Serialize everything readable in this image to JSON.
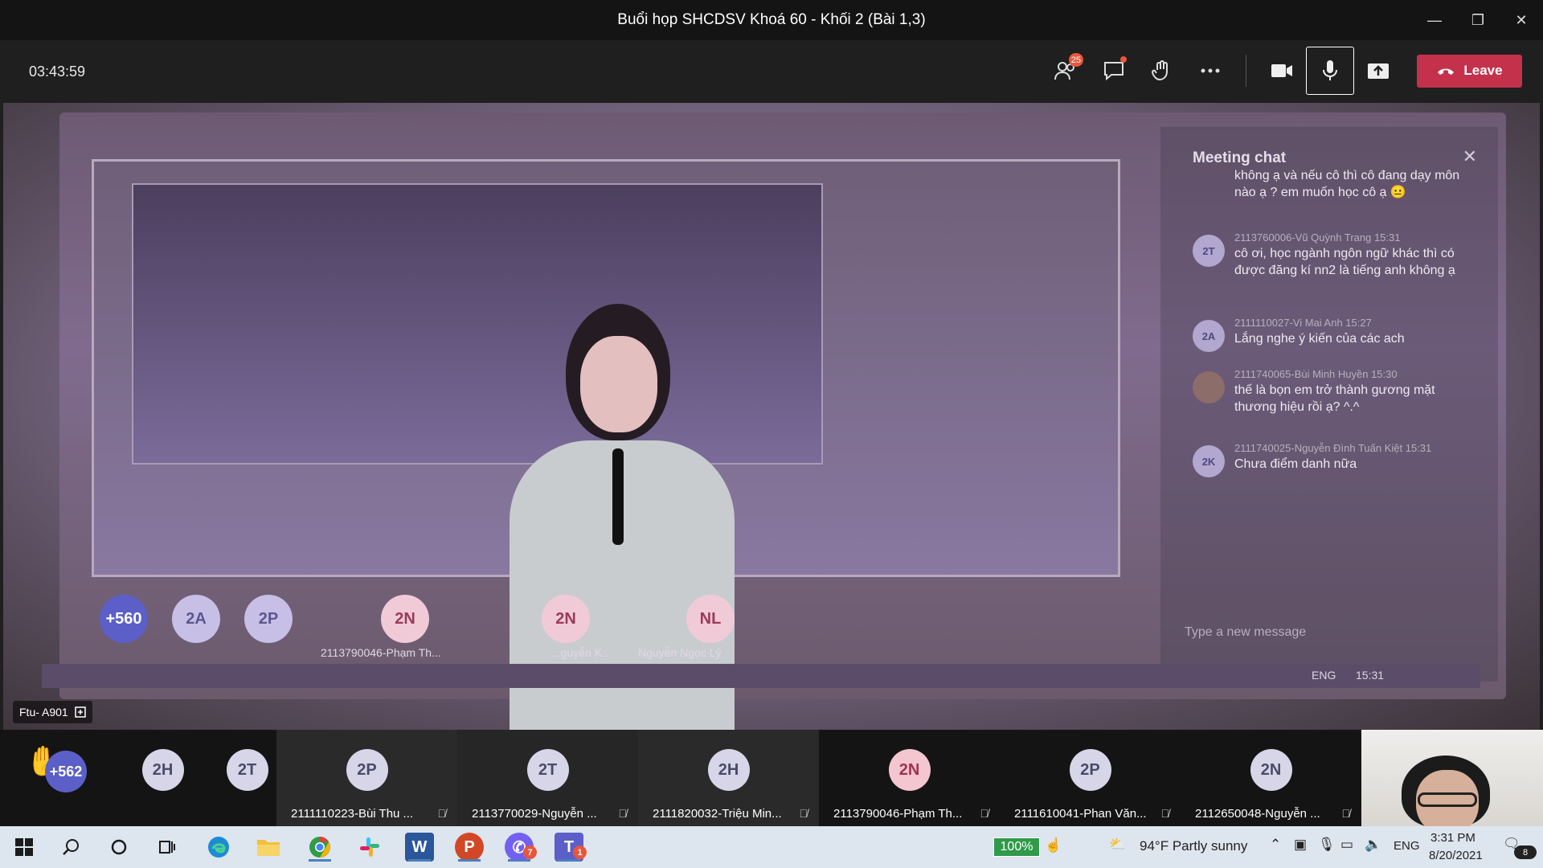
{
  "window": {
    "title": "Buổi họp SHCDSV Khoá 60 - Khối 2 (Bài 1,3)",
    "minimize": "—",
    "restore": "❐",
    "close": "✕"
  },
  "toolbar": {
    "timer": "03:43:59",
    "participants_count": "25",
    "leave_label": "Leave"
  },
  "stage": {
    "room_label": "Ftu- A901",
    "chat": {
      "title": "Meeting chat",
      "messages": [
        {
          "avatar": "",
          "meta": "",
          "text": "không ạ và nếu cô thì cô đang dạy môn nào ạ ? em muốn học cô ạ 😐"
        },
        {
          "avatar": "2T",
          "meta": "2113760006-Vũ Quỳnh Trang   15:31",
          "text": "cô ơi, học ngành ngôn ngữ khác thì có được đăng kí nn2 là tiếng anh không ạ"
        },
        {
          "avatar": "2A",
          "meta": "2111110027-Vi Mai Anh   15:27",
          "text": "Lắng nghe ý kiến của các ach"
        },
        {
          "avatar": "",
          "meta": "2111740065-Bùi Minh Huyền   15:30",
          "text": "thế là bọn em trở thành gương mặt thương hiệu rồi ạ? ^.^"
        },
        {
          "avatar": "2K",
          "meta": "2111740025-Nguyễn Đình Tuấn Kiệt   15:31",
          "text": "Chưa điểm danh nữa"
        }
      ],
      "input_placeholder": "Type a new message"
    },
    "gallery_on_screen": [
      {
        "avatar": "+560",
        "name": ""
      },
      {
        "avatar": "2A",
        "name": ""
      },
      {
        "avatar": "2P",
        "name": ""
      },
      {
        "avatar": "2N",
        "name": "2113790046-Phạm Th..."
      },
      {
        "avatar": "2N",
        "name": "...guyễn K..."
      },
      {
        "avatar": "NL",
        "name": "Nguyễn Ngọc Lý"
      }
    ],
    "screen_taskbar": {
      "lang": "ENG",
      "time": "15:31"
    }
  },
  "gallery": {
    "overflow_label": "+562",
    "tiles": [
      {
        "avatar": "2H",
        "name": "",
        "color": "#d7d6e8",
        "fg": "#4b4b6b"
      },
      {
        "avatar": "2T",
        "name": "",
        "color": "#d7d6e8",
        "fg": "#4b4b6b"
      },
      {
        "avatar": "2P",
        "name": "2111110223-Bùi Thu ...",
        "color": "#d7d6e8",
        "fg": "#4b4b6b"
      },
      {
        "avatar": "2T",
        "name": "2113770029-Nguyễn ...",
        "color": "#d7d6e8",
        "fg": "#4b4b6b"
      },
      {
        "avatar": "2H",
        "name": "2111820032-Triệu Min...",
        "color": "#d7d6e8",
        "fg": "#4b4b6b"
      },
      {
        "avatar": "2N",
        "name": "2113790046-Phạm Th...",
        "color": "#f4c6cf",
        "fg": "#a3324d"
      },
      {
        "avatar": "2P",
        "name": "2111610041-Phan Văn...",
        "color": "#d7d6e8",
        "fg": "#4b4b6b"
      },
      {
        "avatar": "2N",
        "name": "2112650048-Nguyễn ...",
        "color": "#d7d6e8",
        "fg": "#4b4b6b"
      }
    ]
  },
  "taskbar": {
    "apps": [
      "start",
      "search",
      "cortana",
      "task-view",
      "edge",
      "file-explorer",
      "chrome",
      "slack",
      "word",
      "powerpoint",
      "viber",
      "teams"
    ],
    "viber_badge": "7",
    "teams_badge": "1",
    "zoom_percent": "100%",
    "weather": "94°F  Partly sunny",
    "lang": "ENG",
    "time": "3:31 PM",
    "date": "8/20/2021",
    "notif_count": "8"
  },
  "colors": {
    "leave": "#c4314b",
    "accent": "#5b5fc7",
    "badge": "#e8563c"
  }
}
